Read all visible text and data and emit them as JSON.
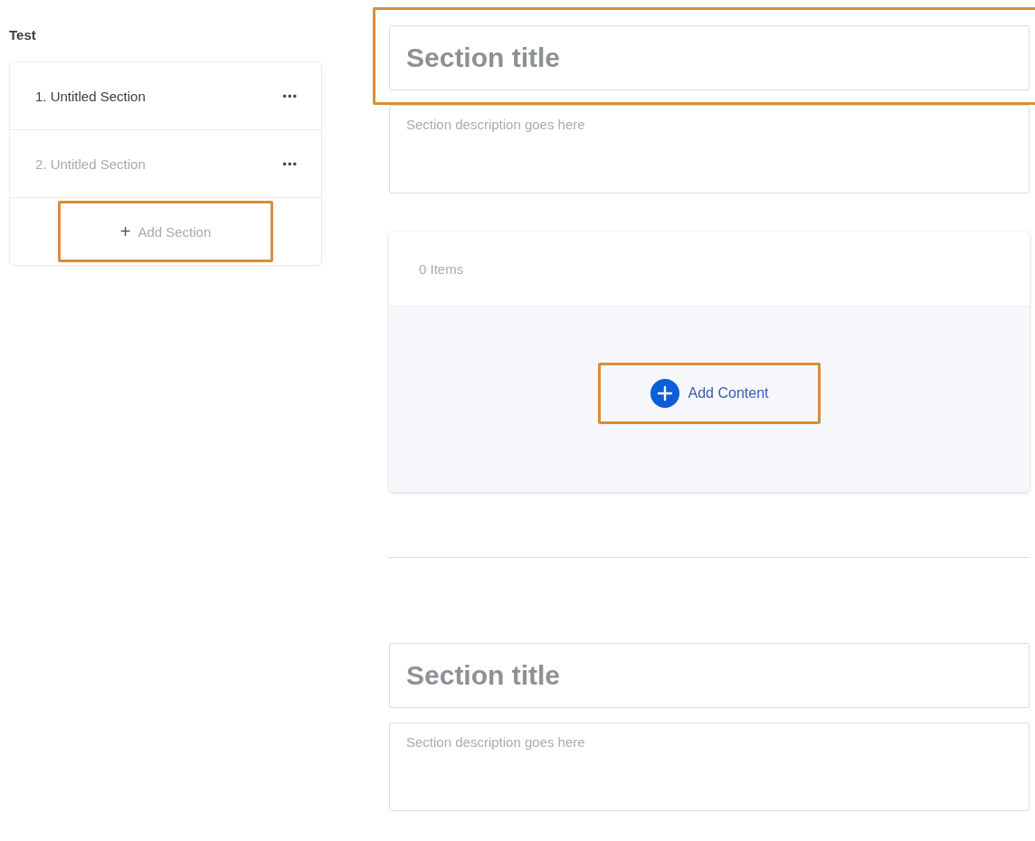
{
  "sidebar": {
    "title": "Test",
    "sections": [
      {
        "label": "1. Untitled Section",
        "menu": "•••",
        "selected": true
      },
      {
        "label": "2. Untitled Section",
        "menu": "•••",
        "selected": false
      }
    ],
    "add_button": {
      "icon": "+",
      "label": "Add Section",
      "highlighted": true
    }
  },
  "sections": [
    {
      "title_placeholder": "Section title",
      "title_highlighted": true,
      "description_placeholder": "Section description goes here",
      "content": {
        "count": "0 Items",
        "add_button": {
          "label": "Add Content",
          "highlighted": true
        }
      }
    },
    {
      "title_placeholder": "Section title",
      "description_placeholder": "Section description goes here"
    }
  ]
}
